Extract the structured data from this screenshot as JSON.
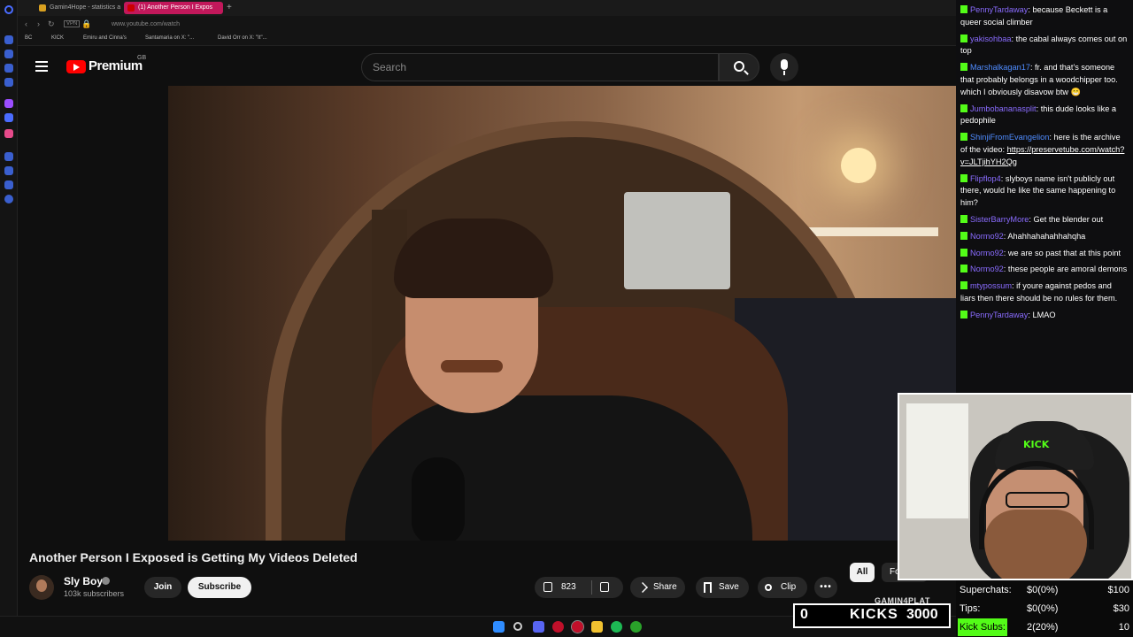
{
  "browser": {
    "tabs": [
      {
        "label": "Gamin4Hope - statistics a",
        "active": false
      },
      {
        "label": "(1) Another Person I Expos",
        "active": true
      }
    ],
    "url": "www.youtube.com/watch",
    "bookmarks": [
      "BC",
      "KICK",
      "Emiru and Cinna's",
      "Santamaria on X: \"...",
      "David Orr on X: \"It\"..."
    ]
  },
  "youtube": {
    "logo_text": "Premium",
    "country_code": "GB",
    "search_placeholder": "Search",
    "video_title": "Another Person I Exposed is Getting My Videos Deleted",
    "channel_name": "Sly Boy",
    "subscribers": "103k subscribers",
    "join_label": "Join",
    "subscribe_label": "Subscribe",
    "likes": "823",
    "share_label": "Share",
    "save_label": "Save",
    "clip_label": "Clip",
    "more_label": "•••",
    "chips": {
      "all": "All",
      "for_you": "For you"
    }
  },
  "chat": [
    {
      "user": "PennyTardaway",
      "text": "because Beckett is a queer social climber"
    },
    {
      "user": "yakisohbaa",
      "text": "the cabal always comes out on top"
    },
    {
      "user": "Marshalkagan17",
      "text": "fr. and that's someone that probably belongs in a woodchipper too. which I obviously disavow btw 😁"
    },
    {
      "user": "Jumbobananasplit",
      "text": "this dude looks like a pedophile"
    },
    {
      "user": "ShinjiFromEvangelion",
      "text": "here is the archive of the video:",
      "link": "https://preservetube.com/watch?v=JLTjihYH2Qg"
    },
    {
      "user": "Flipflop4",
      "text": "slyboys name isn't publicly out there, would he like the same happening to him?"
    },
    {
      "user": "SisterBarryMore",
      "text": "Get the blender out"
    },
    {
      "user": "Normo92",
      "text": "Ahahhahahahhahqha"
    },
    {
      "user": "Normo92",
      "text": "we are so past that at this point"
    },
    {
      "user": "Normo92",
      "text": "these people are amoral demons"
    },
    {
      "user": "mtypossum",
      "text": "if youre against pedos and liars then there should be no rules for them."
    },
    {
      "user": "PennyTardaway",
      "text": "LMAO"
    }
  ],
  "overlay": {
    "cam_hat_text": "KICK",
    "streamer_name": "GAMIN4PLAT",
    "kicks_current": "0",
    "kicks_label": "KICKS",
    "kicks_goal": "3000",
    "stats": [
      {
        "label": "Superchats:",
        "value": "$0(0%)",
        "goal": "$100",
        "highlight": false
      },
      {
        "label": "Tips:",
        "value": "$0(0%)",
        "goal": "$30",
        "highlight": false
      },
      {
        "label": "Kick Subs:",
        "value": "2(20%)",
        "goal": "10",
        "highlight": true
      }
    ]
  },
  "colors": {
    "accent_red": "#ff0000",
    "kick_green": "#53fc18",
    "chat_user": "#8a6cff",
    "active_tab": "#c2185b"
  }
}
